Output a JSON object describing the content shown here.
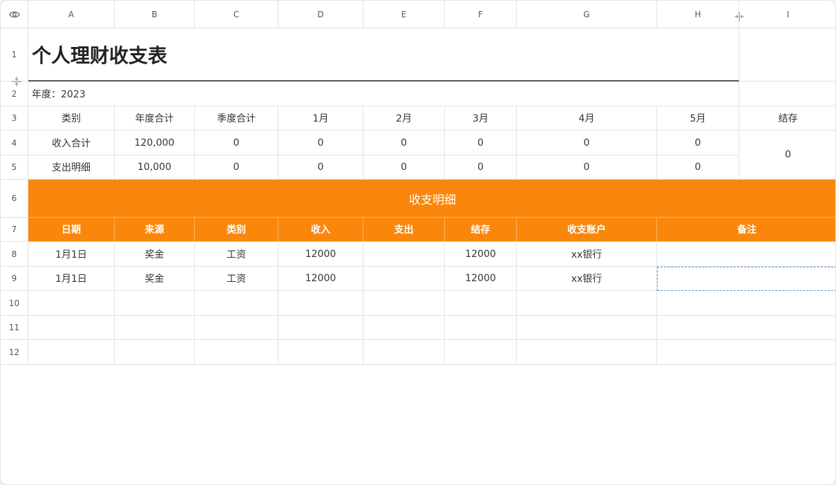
{
  "columns": [
    "A",
    "B",
    "C",
    "D",
    "E",
    "F",
    "G",
    "H",
    "I"
  ],
  "rows": [
    "1",
    "2",
    "3",
    "4",
    "5",
    "6",
    "7",
    "8",
    "9",
    "10",
    "11",
    "12"
  ],
  "title": "个人理财收支表",
  "year_label": "年度：2023",
  "summary": {
    "headers": [
      "类别",
      "年度合计",
      "季度合计",
      "1月",
      "2月",
      "3月",
      "4月",
      "5月",
      "结存"
    ],
    "income": [
      "收入合计",
      "120,000",
      "0",
      "0",
      "0",
      "0",
      "0",
      "0"
    ],
    "expense": [
      "支出明细",
      "10,000",
      "0",
      "0",
      "0",
      "0",
      "0",
      "0"
    ],
    "balance": "0"
  },
  "detail": {
    "band_title": "收支明细",
    "headers": [
      "日期",
      "来源",
      "类别",
      "收入",
      "支出",
      "结存",
      "收支账户",
      "备注"
    ],
    "rows": [
      [
        "1月1日",
        "奖金",
        "工资",
        "12000",
        "",
        "12000",
        "xx银行",
        ""
      ],
      [
        "1月1日",
        "奖金",
        "工资",
        "12000",
        "",
        "12000",
        "xx银行",
        ""
      ]
    ]
  },
  "icons": {
    "corner": "eye-icon",
    "col_resize": "column-resize-icon",
    "row_resize": "row-resize-icon"
  },
  "colors": {
    "accent": "#fa870b",
    "selection": "#3a98e8"
  }
}
